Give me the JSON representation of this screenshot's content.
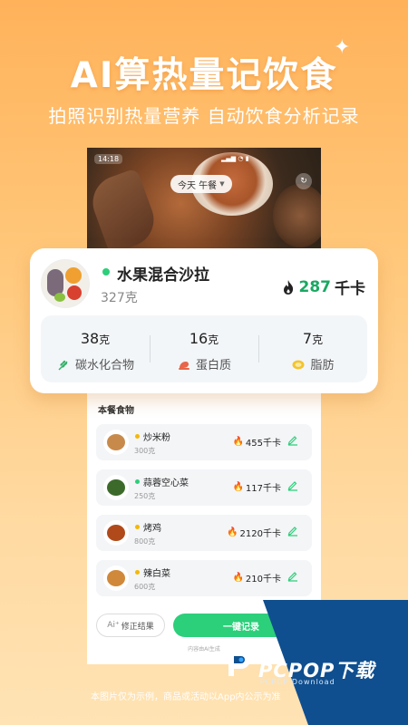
{
  "promo": {
    "headline": "AI算热量记饮食",
    "subline": "拍照识别热量营养 自动饮食分析记录",
    "disclaimer": "本图片仅为示例，商品或活动以App内公示为准"
  },
  "status_bar": {
    "time": "14:18"
  },
  "meal_chip": {
    "label": "今天 午餐"
  },
  "card": {
    "name": "水果混合沙拉",
    "weight": "327克",
    "kcal_value": "287",
    "kcal_unit": "千卡",
    "macros": [
      {
        "value": "38",
        "unit": "克",
        "label": "碳水化合物",
        "icon": "wheat-icon"
      },
      {
        "value": "16",
        "unit": "克",
        "label": "蛋白质",
        "icon": "meat-icon"
      },
      {
        "value": "7",
        "unit": "克",
        "label": "脂肪",
        "icon": "oil-icon"
      }
    ]
  },
  "foods": {
    "title": "本餐食物",
    "items": [
      {
        "name": "炒米粉",
        "weight": "300克",
        "kcal": "455千卡",
        "dot": "#f5b800"
      },
      {
        "name": "蒜蓉空心菜",
        "weight": "250克",
        "kcal": "117千卡",
        "dot": "#2ccf7a"
      },
      {
        "name": "烤鸡",
        "weight": "800克",
        "kcal": "2120千卡",
        "dot": "#f5b800"
      },
      {
        "name": "辣白菜",
        "weight": "600克",
        "kcal": "210千卡",
        "dot": "#f5b800"
      }
    ]
  },
  "actions": {
    "fix_label": "修正结果",
    "record_label": "一键记录",
    "ai_note": "内容由AI生成"
  },
  "watermark": {
    "brand": "PCPOP下载",
    "sub": "PCPOP Download"
  },
  "colors": {
    "accent_green": "#2ccf7a",
    "kcal_green": "#1aa862",
    "flame": "#222222",
    "watermark_blue": "#0f4f8f"
  }
}
